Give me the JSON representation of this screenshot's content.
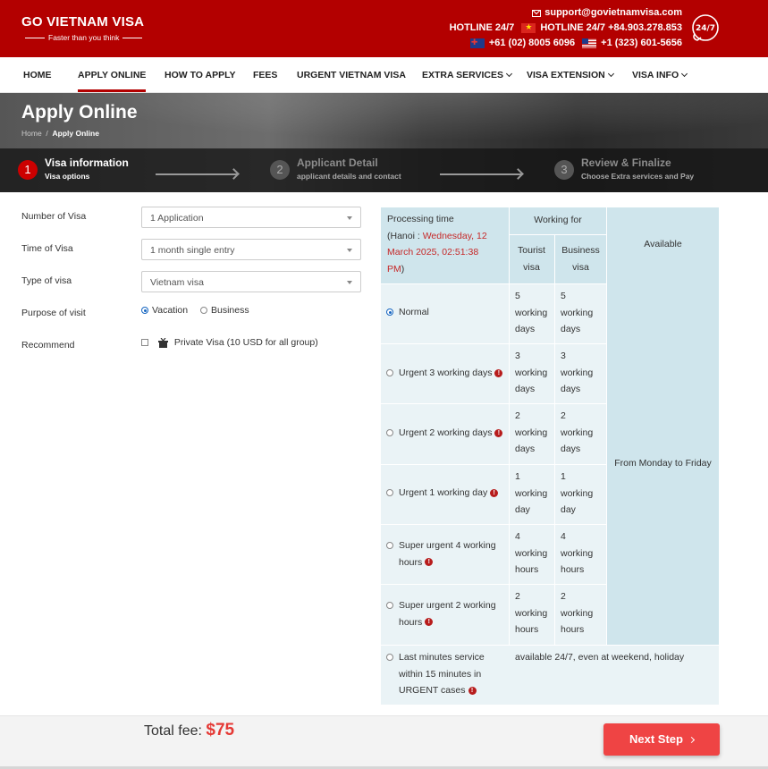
{
  "header": {
    "logo_title": "GO VIETNAM VISA",
    "logo_tagline": "Faster than you think",
    "email": "support@govietnamvisa.com",
    "hotline_label": "HOTLINE 24/7",
    "hotline_vn": "HOTLINE 24/7 +84.903.278.853",
    "phone_nz": "+61 (02) 8005 6096",
    "phone_us": "+1 (323) 601-5656",
    "badge": "24/7"
  },
  "nav": {
    "items": [
      {
        "label": "HOME"
      },
      {
        "label": "APPLY ONLINE"
      },
      {
        "label": "HOW TO APPLY"
      },
      {
        "label": "FEES"
      },
      {
        "label": "URGENT VIETNAM VISA"
      },
      {
        "label": "EXTRA SERVICES"
      },
      {
        "label": "VISA EXTENSION"
      },
      {
        "label": "VISA INFO"
      }
    ]
  },
  "hero": {
    "title": "Apply Online",
    "breadcrumb_home": "Home",
    "breadcrumb_sep": "/",
    "breadcrumb_current": "Apply Online"
  },
  "steps": [
    {
      "num": "1",
      "title": "Visa information",
      "subtitle": "Visa options"
    },
    {
      "num": "2",
      "title": "Applicant Detail",
      "subtitle": "applicant details and contact"
    },
    {
      "num": "3",
      "title": "Review & Finalize",
      "subtitle": "Choose Extra services and Pay"
    }
  ],
  "form": {
    "number_label": "Number of Visa",
    "number_value": "1 Application",
    "time_label": "Time of Visa",
    "time_value": "1 month single entry",
    "type_label": "Type of visa",
    "type_value": "Vietnam visa",
    "purpose_label": "Purpose of visit",
    "purpose_vacation": "Vacation",
    "purpose_business": "Business",
    "recommend_label": "Recommend",
    "recommend_option": "Private Visa (10 USD for all group)"
  },
  "table": {
    "processing_time": "Processing time",
    "hanoi_prefix": "(Hanoi :",
    "hanoi_time_1": "Wednesday, 12",
    "hanoi_time_2": "March 2025, 02:51:38",
    "hanoi_time_3": "PM",
    "hanoi_suffix": ")",
    "working_for": "Working for",
    "tourist": [
      "Tourist",
      "visa"
    ],
    "business": [
      "Business",
      "visa"
    ],
    "available": "Available",
    "available_value": "From Monday to Friday",
    "rows": [
      {
        "label": "Normal",
        "t": [
          "5",
          "working",
          "days"
        ],
        "b": [
          "5",
          "working",
          "days"
        ]
      },
      {
        "label": "Urgent 3 working days",
        "t": [
          "3",
          "working",
          "days"
        ],
        "b": [
          "3",
          "working",
          "days"
        ]
      },
      {
        "label": "Urgent 2 working days",
        "t": [
          "2",
          "working",
          "days"
        ],
        "b": [
          "2",
          "working",
          "days"
        ]
      },
      {
        "label": "Urgent 1 working day",
        "t": [
          "1",
          "working",
          "day"
        ],
        "b": [
          "1",
          "working",
          "day"
        ]
      },
      {
        "label1": "Super urgent 4 working",
        "label2": "hours",
        "t": [
          "4",
          "working",
          "hours"
        ],
        "b": [
          "4",
          "working",
          "hours"
        ]
      },
      {
        "label1": "Super urgent 2 working",
        "label2": "hours",
        "t": [
          "2",
          "working",
          "hours"
        ],
        "b": [
          "2",
          "working",
          "hours"
        ]
      }
    ],
    "last": {
      "l1": "Last minutes service",
      "l2": "within 15 minutes in",
      "l3": "URGENT cases",
      "avail": "available 24/7, even at weekend, holiday"
    }
  },
  "footer": {
    "total_label": "Total fee:",
    "total_amount": "$75",
    "next_label": "Next Step"
  },
  "colors": {
    "brand": "#b30000",
    "accent": "#ef4444",
    "table_bg": "#eaf3f6",
    "table_header": "#cfe5ec"
  }
}
